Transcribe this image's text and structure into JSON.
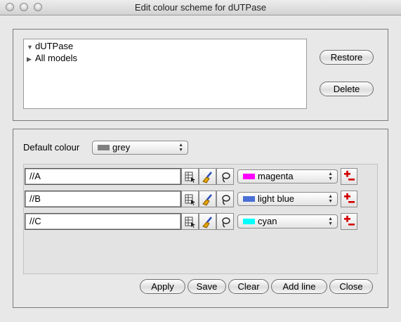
{
  "window": {
    "title": "Edit colour scheme for dUTPase"
  },
  "tree": {
    "items": [
      {
        "label": "dUTPase",
        "expanded": true
      },
      {
        "label": "All models",
        "expanded": false
      }
    ]
  },
  "buttons": {
    "restore": "Restore",
    "delete": "Delete"
  },
  "default_colour": {
    "label": "Default colour",
    "value": "grey",
    "swatch": "#808080"
  },
  "rules": [
    {
      "selection": "//A",
      "colour": "magenta",
      "swatch": "#ff00ff"
    },
    {
      "selection": "//B",
      "colour": "light blue",
      "swatch": "#4a6fd6"
    },
    {
      "selection": "//C",
      "colour": "cyan",
      "swatch": "#00ffff"
    }
  ],
  "actions": {
    "apply": "Apply",
    "save": "Save",
    "clear": "Clear",
    "add_line": "Add line",
    "close": "Close"
  },
  "icons": {
    "pick": "table-pick-icon",
    "brush": "paint-brush-icon",
    "lasso": "lasso-icon",
    "delete": "add-remove-icon"
  }
}
